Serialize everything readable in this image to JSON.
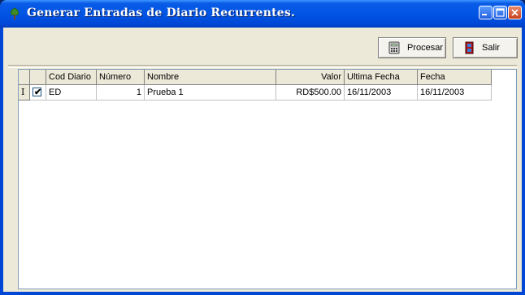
{
  "window": {
    "title": "Generar Entradas de Diario Recurrentes.",
    "app_icon": "tree-icon",
    "controls": [
      "minimize-icon",
      "maximize-icon",
      "close-icon"
    ]
  },
  "toolbar": {
    "procesar_label": "Procesar",
    "procesar_icon": "calculator-icon",
    "salir_label": "Salir",
    "salir_icon": "exit-door-icon"
  },
  "grid": {
    "columns": [
      "",
      "",
      "Cod Diario",
      "Número",
      "Nombre",
      "Valor",
      "Ultima Fecha",
      "Fecha"
    ],
    "rows": [
      {
        "indicator": "I",
        "selected": true,
        "cod_diario": "ED",
        "numero": "1",
        "nombre": "Prueba 1",
        "valor": "RD$500.00",
        "ultima_fecha": "16/11/2003",
        "fecha": "16/11/2003"
      }
    ]
  },
  "colors": {
    "titlebar": "#0055e5",
    "client_bg": "#ece9d8",
    "close_button": "#c8401c"
  }
}
